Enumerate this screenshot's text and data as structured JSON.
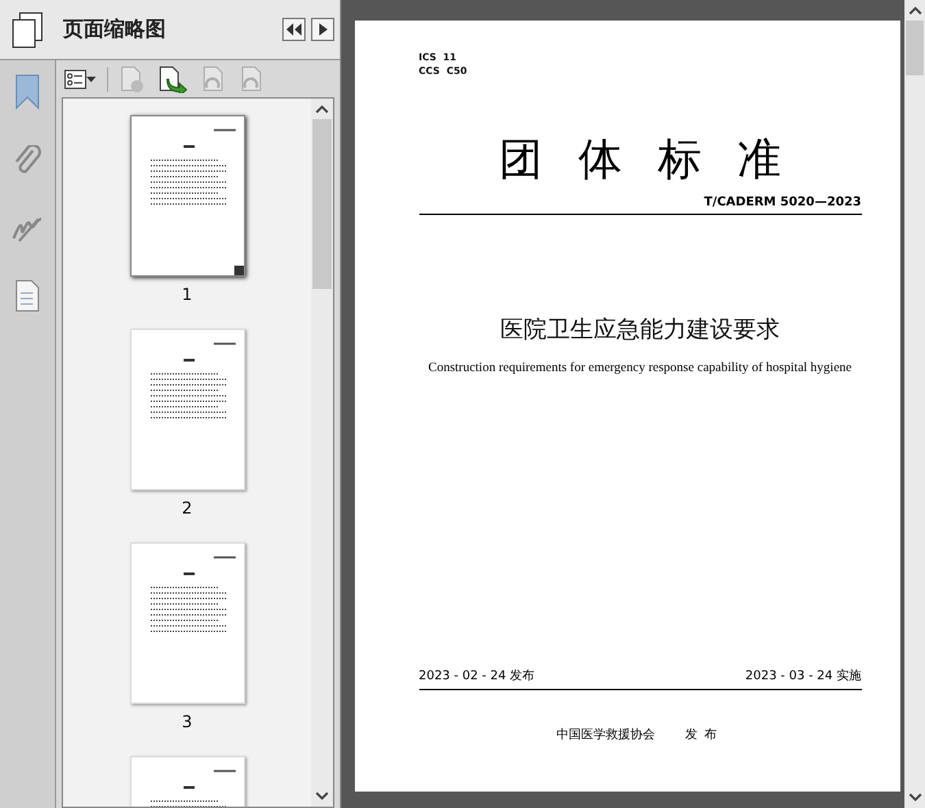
{
  "panel": {
    "title": "页面缩略图"
  },
  "toolbar": [
    {
      "kind": "options",
      "disabled": false
    },
    {
      "kind": "delete",
      "disabled": true
    },
    {
      "kind": "insert",
      "disabled": false
    },
    {
      "kind": "rotate-left",
      "disabled": true
    },
    {
      "kind": "rotate-right",
      "disabled": true
    }
  ],
  "thumbnails": [
    {
      "label": "1",
      "selected": true
    },
    {
      "label": "2",
      "selected": false
    },
    {
      "label": "3",
      "selected": false
    },
    {
      "selected": false
    }
  ],
  "document": {
    "ics": "ICS  11",
    "ccs": "CCS  C50",
    "heading": "团体标准",
    "code": "T/CADERM 5020—2023",
    "title": "医院卫生应急能力建设要求",
    "subtitle": "Construction requirements for emergency response capability of hospital hygiene",
    "issued": "2023 - 02 - 24 发布",
    "effective": "2023 - 03 - 24 实施",
    "publisher": "中国医学救援协会",
    "publisher_action": "发布"
  }
}
